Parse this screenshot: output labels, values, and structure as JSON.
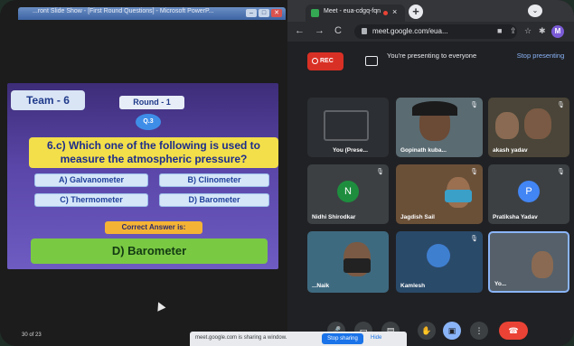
{
  "ppt": {
    "window_title": "...ront Slide Show - [First Round Questions] - Microsoft PowerP...",
    "win_buttons": [
      "–",
      "□",
      "✕"
    ],
    "slide_count": "30 of 23",
    "slide": {
      "team": "Team - 6",
      "round": "Round - 1",
      "question_no": "Q.3",
      "question": "6.c) Which one of the following is used to measure the atmospheric pressure?",
      "options": [
        "A) Galvanometer",
        "B) Clinometer",
        "C) Thermometer",
        "D) Barometer"
      ],
      "correct_label": "Correct Answer is:",
      "answer": "D) Barometer"
    }
  },
  "chrome": {
    "tab_label": "Meet - eua-cdgq-fqn",
    "tab_close": "×",
    "new_tab": "+",
    "tab_menu": "⌄",
    "url": "meet.google.com/eua...",
    "profile": "M",
    "nav": [
      "←",
      "→",
      "C"
    ]
  },
  "meet": {
    "rec": "REC",
    "presenting_text": "You're presenting to everyone",
    "stop_presenting": "Stop presenting",
    "tiles": [
      {
        "name": "You (Prese...",
        "kind": "screen"
      },
      {
        "name": "Gopinath kuba...",
        "kind": "video"
      },
      {
        "name": "akash yadav",
        "kind": "video"
      },
      {
        "name": "Nidhi Shirodkar",
        "kind": "avatar",
        "initial": "N",
        "color": "#1e8e3e"
      },
      {
        "name": "Jagdish Sail",
        "kind": "video"
      },
      {
        "name": "Pratiksha Yadav",
        "kind": "avatar",
        "initial": "P",
        "color": "#4285f4"
      },
      {
        "name": "...Naik",
        "kind": "video"
      },
      {
        "name": "Kamlesh",
        "kind": "video"
      },
      {
        "name": "Yo...",
        "kind": "video"
      }
    ],
    "share_text": "meet.google.com is sharing a window.",
    "stop_sharing": "Stop sharing",
    "hide": "Hide"
  }
}
